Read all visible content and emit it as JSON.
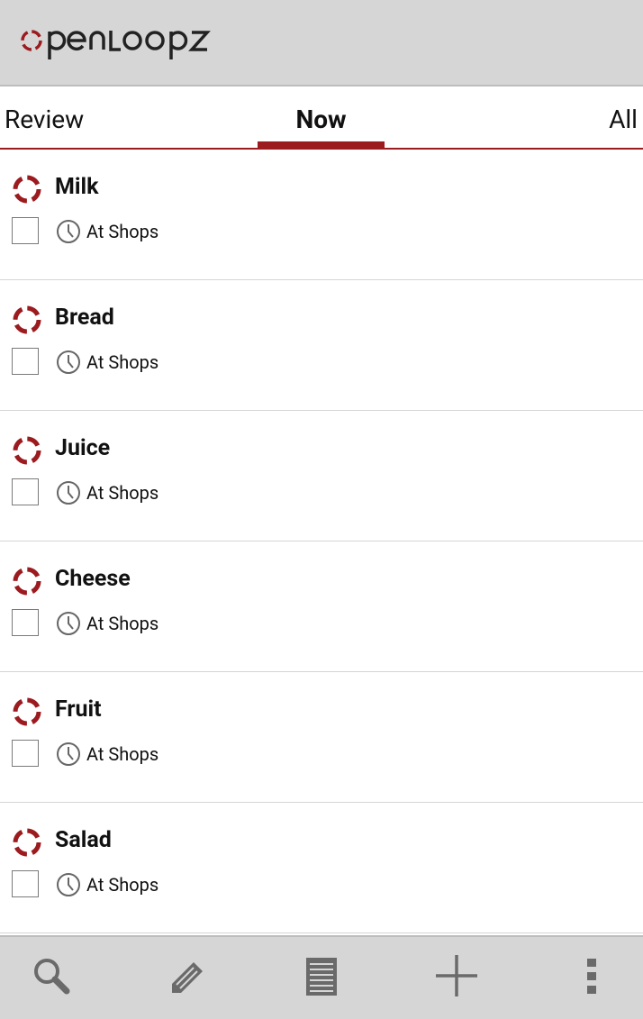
{
  "app": {
    "logo_text": "openloopz",
    "brand_color": "#9b1b1f"
  },
  "tabs": [
    {
      "label": "Review",
      "selected": false
    },
    {
      "label": "Now",
      "selected": true
    },
    {
      "label": "All",
      "selected": false
    }
  ],
  "items": [
    {
      "title": "Milk",
      "context": "At Shops",
      "checked": false
    },
    {
      "title": "Bread",
      "context": "At Shops",
      "checked": false
    },
    {
      "title": "Juice",
      "context": "At Shops",
      "checked": false
    },
    {
      "title": "Cheese",
      "context": "At Shops",
      "checked": false
    },
    {
      "title": "Fruit",
      "context": "At Shops",
      "checked": false
    },
    {
      "title": "Salad",
      "context": "At Shops",
      "checked": false
    }
  ],
  "icons": {
    "status": "open-loop-icon",
    "context": "clock-icon",
    "bottom_bar": [
      "search-icon",
      "pencil-icon",
      "list-icon",
      "plus-icon",
      "overflow-menu-icon"
    ]
  }
}
